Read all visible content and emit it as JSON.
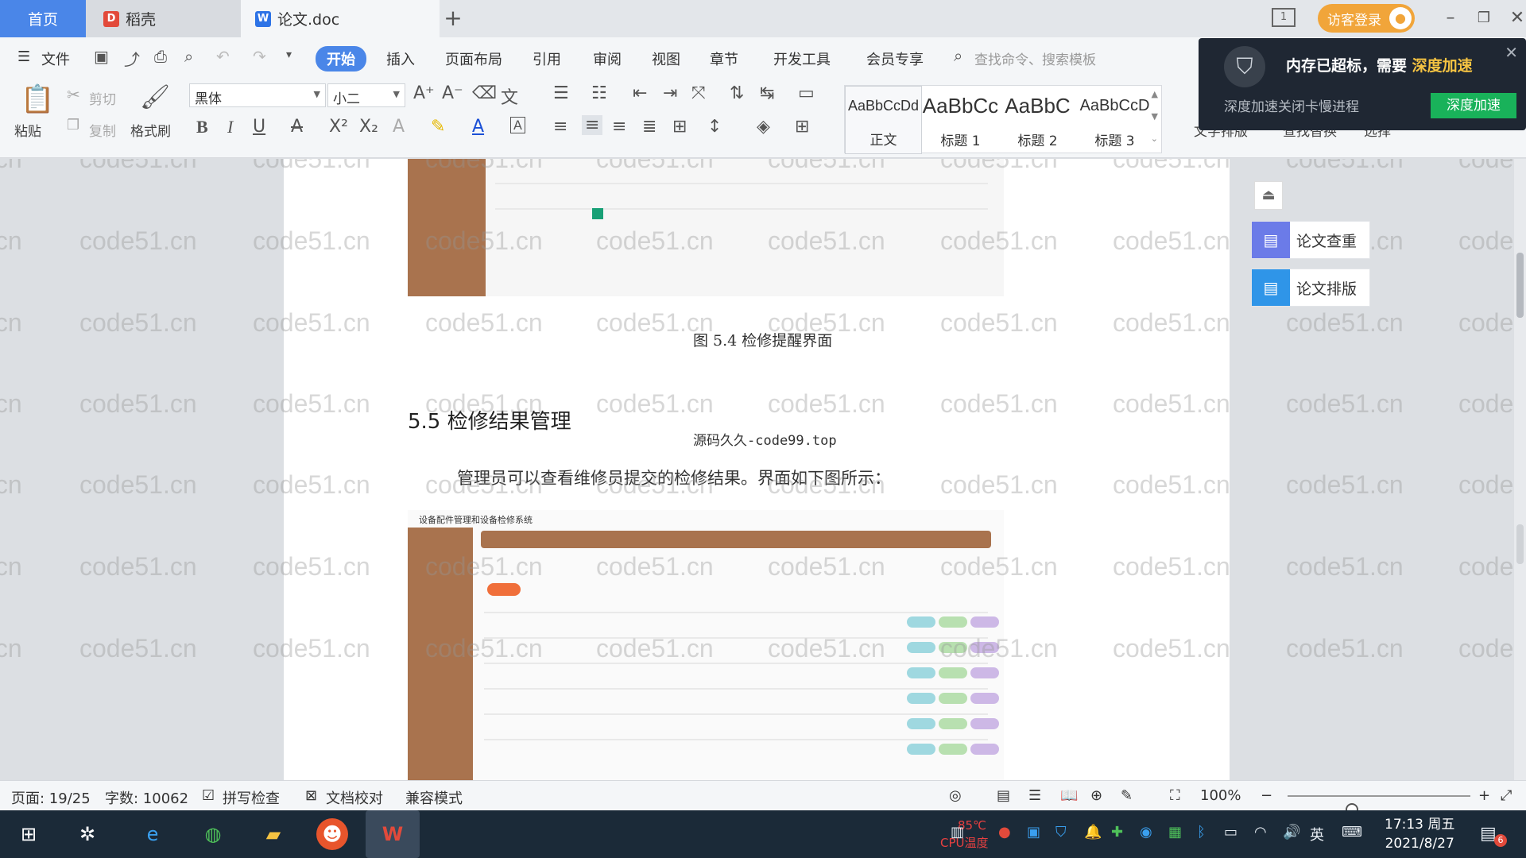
{
  "titlebar": {
    "tabs": [
      {
        "label": "首页"
      },
      {
        "label": "稻壳",
        "icon": "daoke-logo-icon"
      },
      {
        "label": "论文.doc",
        "icon": "wps-writer-icon"
      }
    ],
    "visitor_login": "访客登录"
  },
  "ribbon": {
    "file_menu": "文件",
    "menus": [
      "开始",
      "插入",
      "页面布局",
      "引用",
      "审阅",
      "视图",
      "章节",
      "开发工具",
      "会员专享"
    ],
    "search_placeholder": "查找命令、搜索模板",
    "paste": "粘贴",
    "cut": "剪切",
    "copy": "复制",
    "format_painter": "格式刷",
    "font_name": "黑体",
    "font_size": "小二",
    "styles": [
      {
        "preview": "AaBbCcDd",
        "name": "正文"
      },
      {
        "preview": "AaBbCc",
        "name": "标题 1"
      },
      {
        "preview": "AaBbC",
        "name": "标题 2"
      },
      {
        "preview": "AaBbCcD",
        "name": "标题 3"
      }
    ],
    "right_tools": [
      "文字排版",
      "查找替换",
      "选择"
    ]
  },
  "notification": {
    "message": "内存已超标，需要",
    "highlight": "深度加速",
    "sub": "深度加速关闭卡慢进程",
    "button": "深度加速"
  },
  "document": {
    "figure_caption": "图 5.4  检修提醒界面",
    "section_title": "5.5  检修结果管理",
    "source_mark": "源码久久-code99.top",
    "paragraph": "管理员可以查看维修员提交的检修结果。界面如下图所示：",
    "screenshot_title": "设备配件管理和设备检修系统"
  },
  "side_tools": {
    "check": "论文查重",
    "layout": "论文排版"
  },
  "watermark": "code51.cn",
  "statusbar": {
    "page": "页面: 19/25",
    "words": "字数: 10062",
    "spell": "拼写检查",
    "proof": "文档校对",
    "compat": "兼容模式",
    "zoom": "100%",
    "zoom_level": 0.35
  },
  "taskbar": {
    "cpu_temp": "85℃",
    "cpu_label": "CPU温度",
    "ime": "英",
    "time": "17:13 周五",
    "date": "2021/8/27",
    "notifications": "6"
  }
}
